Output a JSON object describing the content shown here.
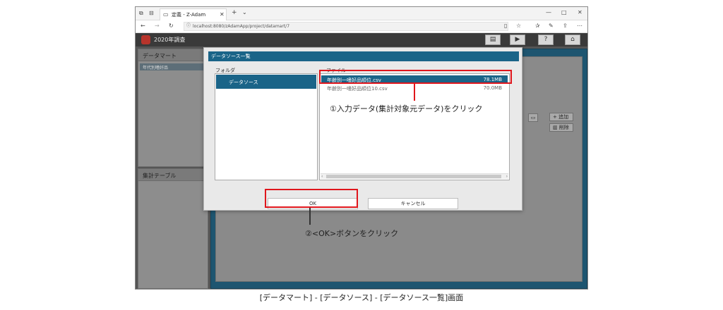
{
  "browser": {
    "tab_title": "定義 - Z-Adam",
    "url": "localhost:8080/zAdamApp/project/datamart/7"
  },
  "app": {
    "title": "2020年調査"
  },
  "background": {
    "datamart_title": "データマート",
    "datamart_item": "年代別嗜好品",
    "summary_title": "集計テーブル",
    "add_label": "追加",
    "delete_label": "削除"
  },
  "dialog": {
    "title": "データソース一覧",
    "folder_label": "フォルダ",
    "file_label": "ファイル",
    "folders": [
      "データソース"
    ],
    "files": [
      {
        "name": "年齢別一嗜好品順位.csv",
        "size": "78.1MB"
      },
      {
        "name": "年齢別一嗜好品順位10.csv",
        "size": "70.0MB"
      }
    ],
    "ok_label": "OK",
    "cancel_label": "キャンセル"
  },
  "annotations": {
    "step1": "①入力データ(集計対象元データ)をクリック",
    "step2": "②<OK>ボタンをクリック",
    "highlight_color": "#e0161c"
  },
  "caption": "[データマート] - [データソース] - [データソース一覧]画面",
  "colors": {
    "accent": "#1a6488",
    "app_header": "#3a3a3a",
    "logo": "#b8342b"
  }
}
